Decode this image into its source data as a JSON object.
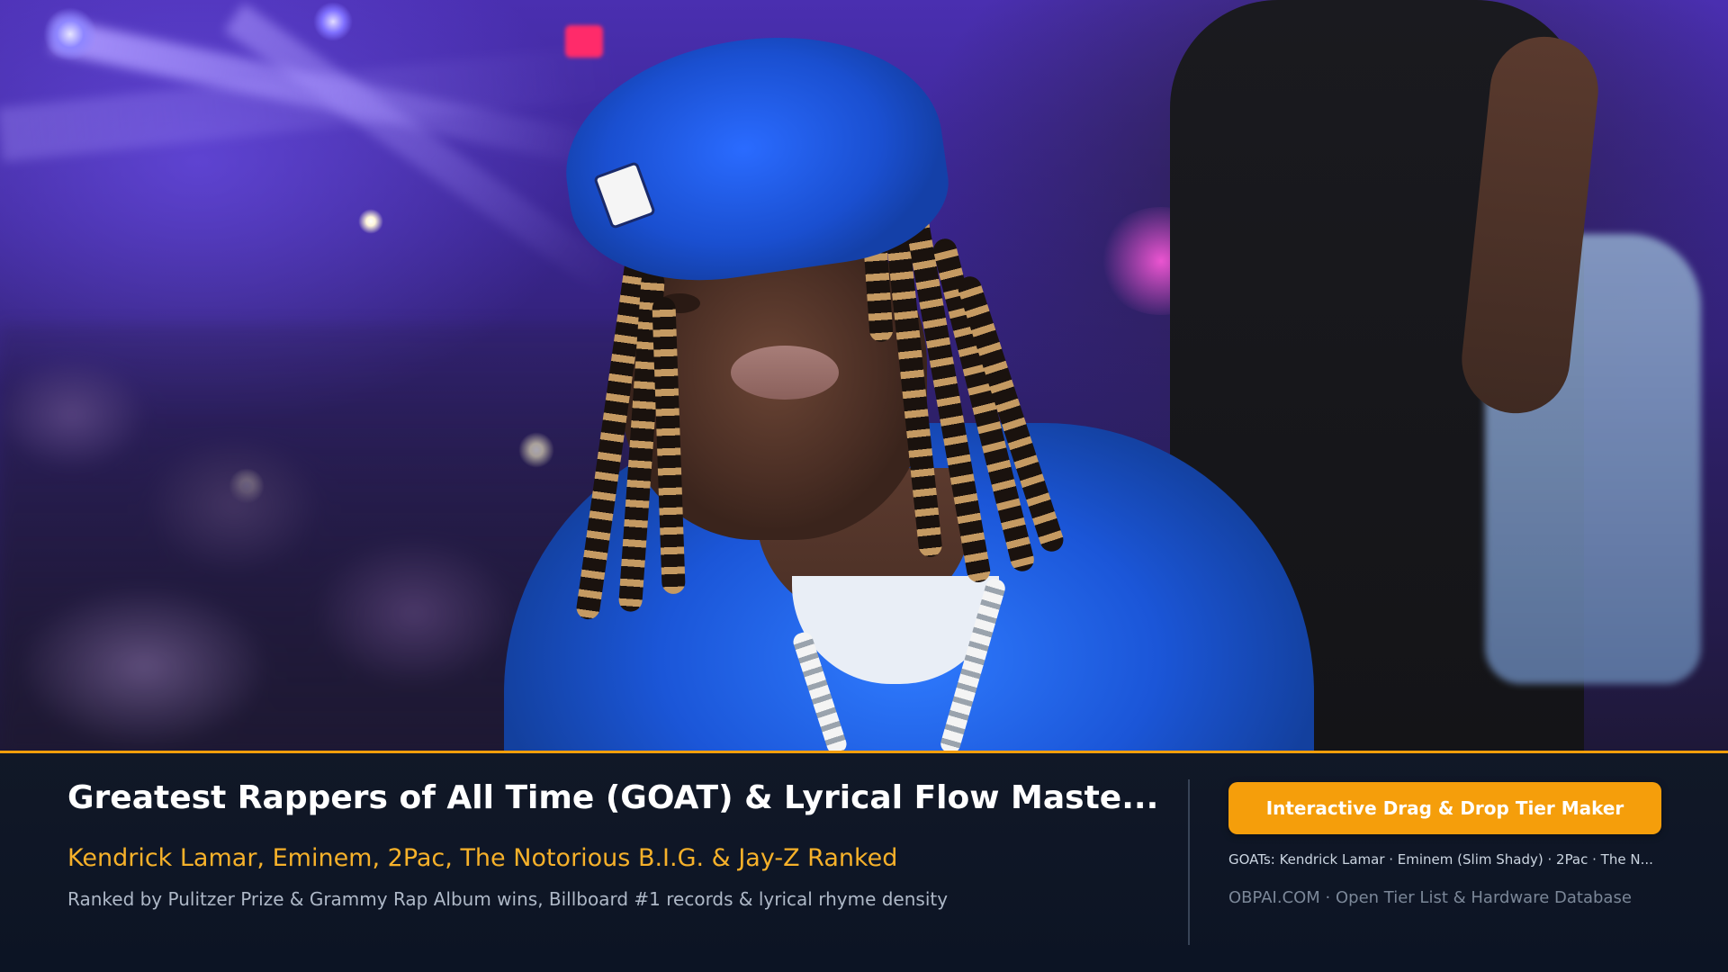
{
  "hero": {
    "image_alt": "Rapper in blue cap and hoodie at a nightclub"
  },
  "info": {
    "title": "Greatest Rappers of All Time (GOAT) & Lyrical Flow Maste...",
    "subtitle": "Kendrick Lamar, Eminem, 2Pac, The Notorious B.I.G. & Jay-Z Ranked",
    "description": "Ranked by Pulitzer Prize & Grammy Rap Album wins, Billboard #1 records & lyrical rhyme density",
    "cta_label": "Interactive Drag & Drop Tier Maker",
    "goats_line": "GOATs: Kendrick Lamar · Eminem (Slim Shady) · 2Pac · The N...",
    "site_line": "OBPAI.COM · Open Tier List & Hardware Database"
  },
  "colors": {
    "accent": "#f59e0b",
    "subtitle": "#f6b12a",
    "panel_bg": "#111827",
    "title": "#ffffff",
    "muted": "#aeb8c7"
  }
}
